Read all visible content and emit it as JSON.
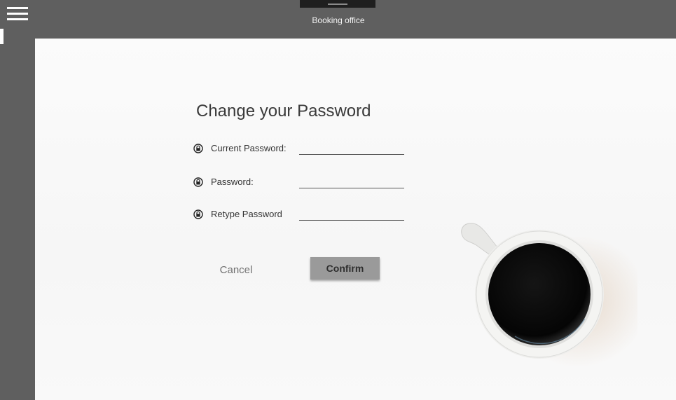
{
  "app": {
    "title": "Booking office"
  },
  "nav": {
    "menu_icon": "hamburger-menu-icon"
  },
  "form": {
    "title": "Change your Password",
    "fields": [
      {
        "label": "Current Password:",
        "value": "",
        "icon": "lock-icon"
      },
      {
        "label": "Password:",
        "value": "",
        "icon": "lock-icon"
      },
      {
        "label": "Retype Password",
        "value": "",
        "icon": "lock-icon"
      }
    ],
    "cancel_label": "Cancel",
    "confirm_label": "Confirm"
  },
  "colors": {
    "chrome": "#5f5f5f",
    "content_bg": "#f8f8f8",
    "confirm_button": "#9a9a9a",
    "text": "#3a3a3a"
  }
}
